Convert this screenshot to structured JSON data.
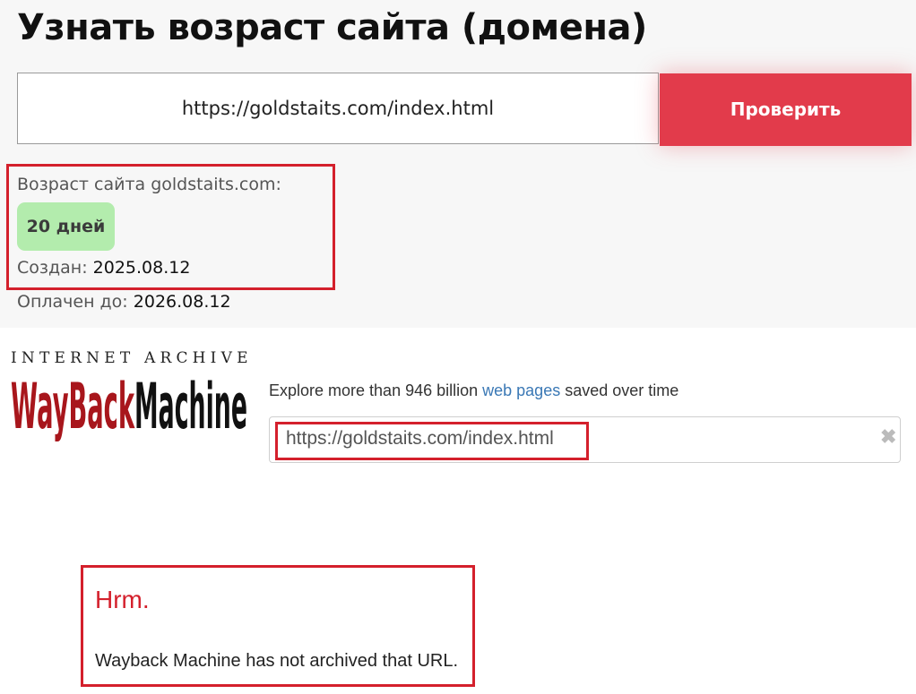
{
  "checker": {
    "title": "Узнать возраст сайта (домена)",
    "url_value": "https://goldstaits.com/index.html",
    "check_button": "Проверить",
    "age_label": "Возраст сайта goldstaits.com:",
    "age_value": "20 дней",
    "created_label": "Создан:",
    "created_value": "2025.08.12",
    "paid_label": "Оплачен до:",
    "paid_value": "2026.08.12"
  },
  "wayback": {
    "ia_text": "INTERNET ARCHIVE",
    "logo_wayback": "WayBack",
    "logo_machine": "Machine",
    "explore_prefix": "Explore more than 946 billion ",
    "explore_link": "web pages",
    "explore_suffix": " saved over time",
    "search_value": "https://goldstaits.com/index.html",
    "clear_icon": "✖",
    "hrm": "Hrm.",
    "not_archived": "Wayback Machine has not archived that URL."
  },
  "colors": {
    "accent_red": "#e23b4b",
    "highlight_red": "#d4202c",
    "badge_green": "#b3ecad",
    "link_blue": "#3a78b5",
    "logo_red": "#a8161c"
  }
}
